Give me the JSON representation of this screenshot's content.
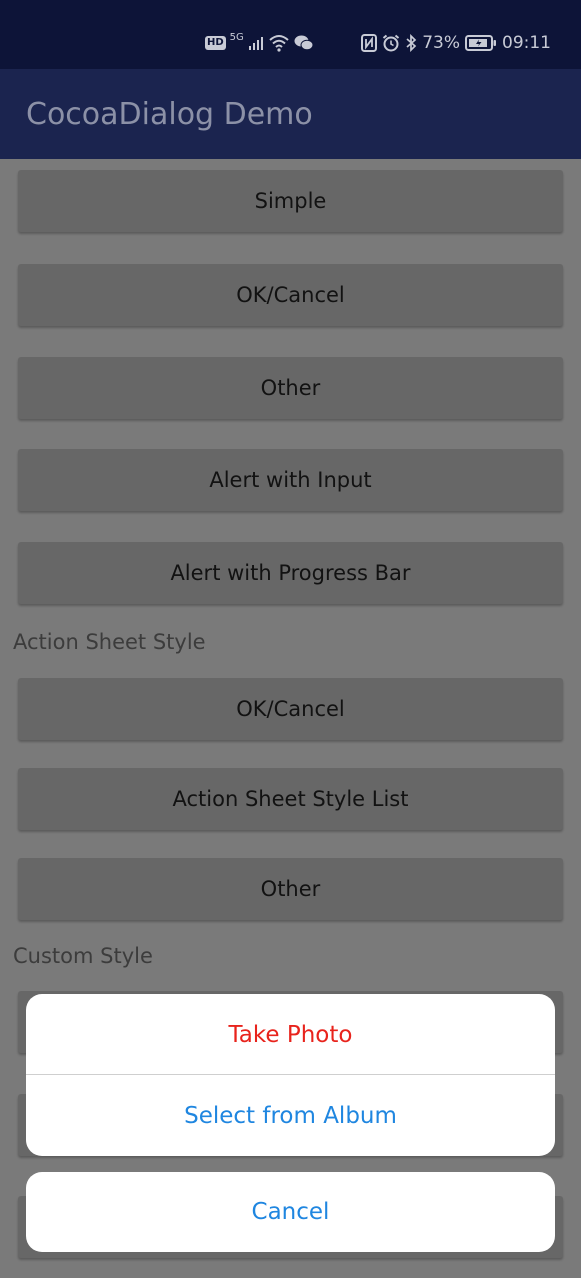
{
  "status_bar": {
    "left": {
      "hd_badge": "HD",
      "network": "5G",
      "icons": [
        "signal-icon",
        "wifi-icon",
        "wechat-icon"
      ]
    },
    "right": {
      "icons": [
        "nfc-icon",
        "alarm-icon",
        "bluetooth-icon"
      ],
      "battery_percent": "73%",
      "battery_icon": "battery-charging-icon",
      "time": "09:11"
    }
  },
  "app_bar": {
    "title": "CocoaDialog Demo"
  },
  "alert_section": {
    "buttons": [
      {
        "label": "Simple"
      },
      {
        "label": "OK/Cancel"
      },
      {
        "label": "Other"
      },
      {
        "label": "Alert with Input"
      },
      {
        "label": "Alert with Progress Bar"
      }
    ]
  },
  "action_sheet_section": {
    "label": "Action Sheet Style",
    "buttons": [
      {
        "label": "OK/Cancel"
      },
      {
        "label": "Action Sheet Style List"
      },
      {
        "label": "Other"
      }
    ]
  },
  "custom_section": {
    "label": "Custom Style"
  },
  "action_sheet": {
    "items": [
      {
        "label": "Take Photo",
        "color": "#e8231c"
      },
      {
        "label": "Select from Album",
        "color": "#1f86e0"
      }
    ],
    "cancel": {
      "label": "Cancel",
      "color": "#1f86e0"
    }
  },
  "colors": {
    "status_bar_bg": "#0d1438",
    "app_bar_bg": "#1b244f",
    "destructive": "#e8231c",
    "accent": "#1f86e0"
  }
}
